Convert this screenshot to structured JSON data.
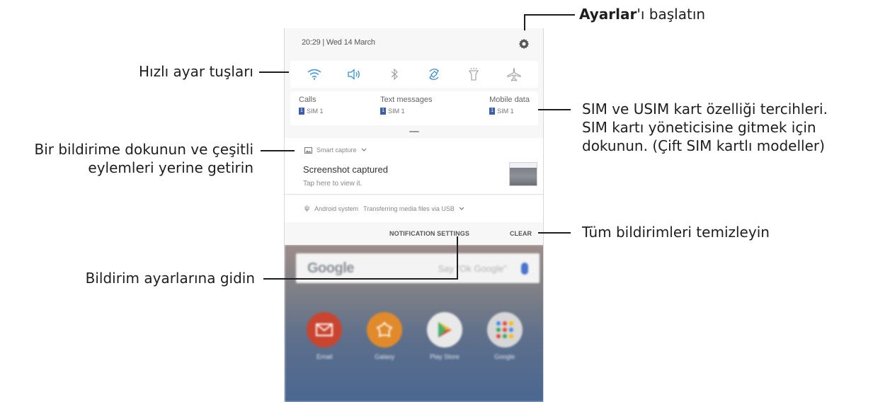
{
  "status_bar": {
    "time_date": "20:29  |  Wed 14 March"
  },
  "quick_settings": [
    "wifi-icon",
    "sound-icon",
    "bluetooth-icon",
    "auto-rotate-icon",
    "flashlight-icon",
    "airplane-mode-icon"
  ],
  "sim_prefs": [
    {
      "label": "Calls",
      "sim": "SIM 1",
      "badge": "1"
    },
    {
      "label": "Text messages",
      "sim": "SIM 1",
      "badge": "1"
    },
    {
      "label": "Mobile data",
      "sim": "SIM 1",
      "badge": "1"
    }
  ],
  "notification": {
    "app": "Smart capture",
    "title": "Screenshot captured",
    "body": "Tap here to view it."
  },
  "system_notification": {
    "app": "Android system",
    "text": "Transferring media files via USB"
  },
  "actions": {
    "settings": "NOTIFICATION SETTINGS",
    "clear": "CLEAR"
  },
  "home_screen": {
    "search_logo": "Google",
    "search_hint": "Say \"Ok Google\"",
    "apps": [
      {
        "label": "Email",
        "color": "#c9452f"
      },
      {
        "label": "Galaxy",
        "color": "#e08a2c"
      },
      {
        "label": "Play Store",
        "color": "#e9e9e9"
      },
      {
        "label": "Google",
        "color": "#d7d7d7"
      }
    ]
  },
  "callouts": {
    "settings_bold": "Ayarlar",
    "settings_rest": "'ı başlatın",
    "quick_settings": "Hızlı ayar tuşları",
    "sim_1": "SIM ve USIM kart özelliği tercihleri.",
    "sim_2": "SIM kartı yöneticisine gitmek için",
    "sim_3": "dokunun. (Çift SIM kartlı modeller)",
    "notif_1": "Bir bildirime dokunun ve çeşitli",
    "notif_2": "eylemleri yerine getirin",
    "clear": "Tüm bildirimleri temizleyin",
    "notif_settings": "Bildirim ayarlarına gidin"
  }
}
